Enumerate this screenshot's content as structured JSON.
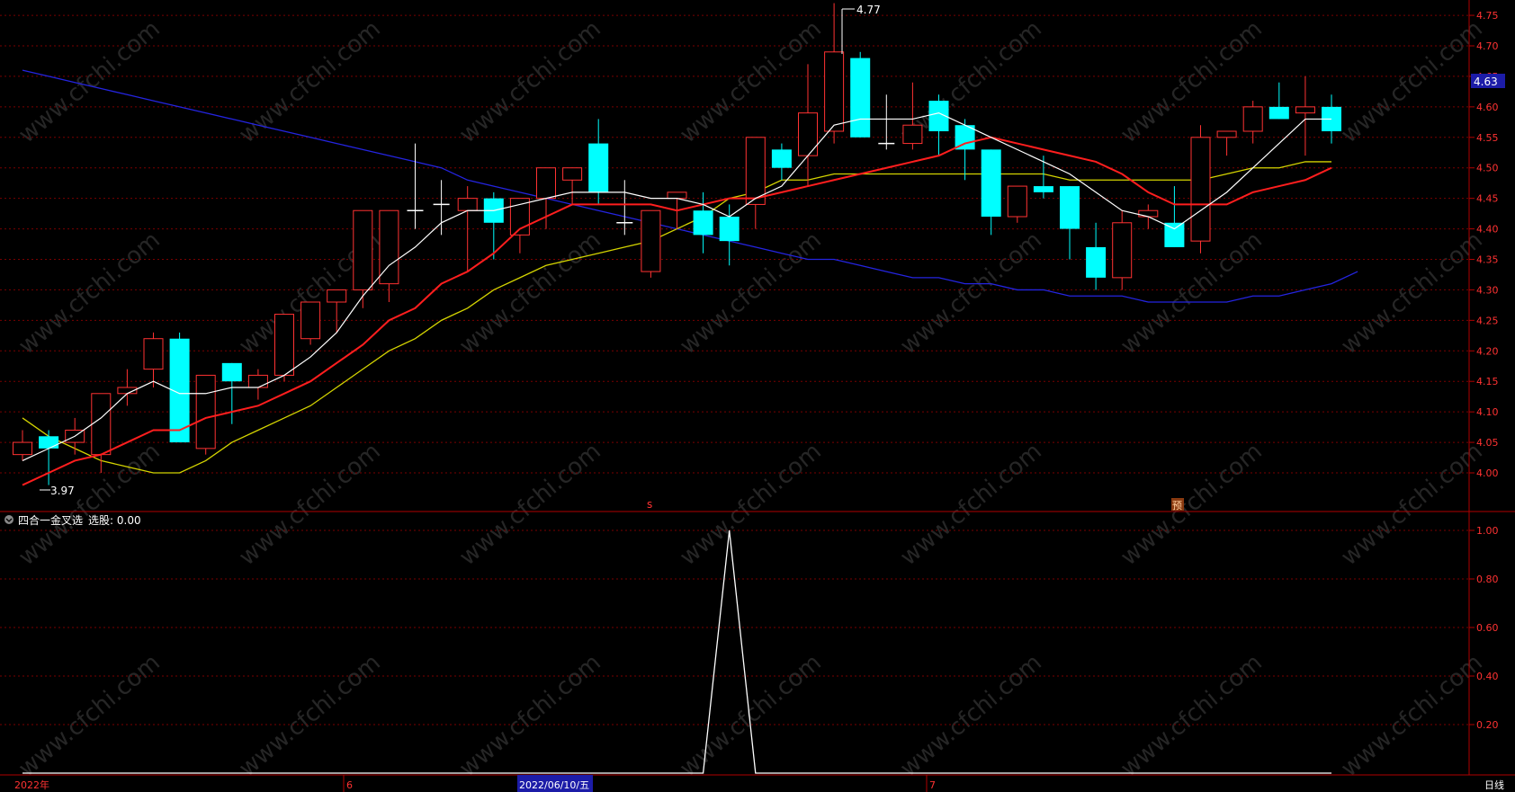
{
  "indicator": {
    "name": "四合一金叉选",
    "signal_label": "选股",
    "signal_value": "0.00",
    "yticks": [
      "1.00",
      "0.80",
      "0.60",
      "0.40",
      "0.20"
    ]
  },
  "timeline": {
    "year_label": "2022年",
    "month_june": "6",
    "month_july": "7",
    "cursor_date": "2022/06/10/五",
    "period": "日线"
  },
  "markers": {
    "s": "s",
    "forecast": "预"
  },
  "price": {
    "current": "4.63",
    "high_note": "4.77",
    "low_note": "3.97"
  },
  "colors": {
    "up": "#ff3232",
    "down": "#00ffff",
    "ma5": "#ffffff",
    "ma10": "#ff1e1e",
    "ma20": "#d4d400",
    "ma60": "#2424e0",
    "grid": "#7a0000",
    "axis": "#b00000"
  },
  "chart_data": [
    {
      "type": "candlestick",
      "ylim": [
        3.93,
        4.78
      ],
      "yticks": [
        4.0,
        4.05,
        4.1,
        4.15,
        4.2,
        4.25,
        4.3,
        4.35,
        4.4,
        4.45,
        4.5,
        4.55,
        4.6,
        4.65,
        4.7,
        4.75
      ],
      "ohlc": [
        [
          4.03,
          4.07,
          4.02,
          4.05
        ],
        [
          4.06,
          4.07,
          3.98,
          4.04
        ],
        [
          4.05,
          4.09,
          4.03,
          4.07
        ],
        [
          4.03,
          4.13,
          4.0,
          4.13
        ],
        [
          4.13,
          4.17,
          4.11,
          4.14
        ],
        [
          4.17,
          4.23,
          4.14,
          4.22
        ],
        [
          4.22,
          4.23,
          4.05,
          4.05
        ],
        [
          4.04,
          4.16,
          4.03,
          4.16
        ],
        [
          4.18,
          4.18,
          4.08,
          4.15
        ],
        [
          4.14,
          4.17,
          4.12,
          4.16
        ],
        [
          4.16,
          4.26,
          4.15,
          4.26
        ],
        [
          4.22,
          4.28,
          4.21,
          4.28
        ],
        [
          4.28,
          4.3,
          4.23,
          4.3
        ],
        [
          4.3,
          4.36,
          4.27,
          4.43
        ],
        [
          4.31,
          4.43,
          4.28,
          4.43
        ],
        [
          4.43,
          4.54,
          4.4,
          4.43
        ],
        [
          4.44,
          4.48,
          4.39,
          4.44
        ],
        [
          4.43,
          4.47,
          4.33,
          4.45
        ],
        [
          4.45,
          4.46,
          4.35,
          4.41
        ],
        [
          4.39,
          4.45,
          4.36,
          4.45
        ],
        [
          4.45,
          4.5,
          4.4,
          4.5
        ],
        [
          4.48,
          4.5,
          4.44,
          4.5
        ],
        [
          4.54,
          4.58,
          4.44,
          4.46
        ],
        [
          4.41,
          4.48,
          4.39,
          4.41
        ],
        [
          4.33,
          4.43,
          4.32,
          4.43
        ],
        [
          4.45,
          4.45,
          4.4,
          4.46
        ],
        [
          4.43,
          4.46,
          4.36,
          4.39
        ],
        [
          4.42,
          4.44,
          4.34,
          4.38
        ],
        [
          4.44,
          4.55,
          4.4,
          4.55
        ],
        [
          4.53,
          4.54,
          4.48,
          4.5
        ],
        [
          4.52,
          4.67,
          4.47,
          4.59
        ],
        [
          4.56,
          4.77,
          4.54,
          4.69
        ],
        [
          4.68,
          4.69,
          4.55,
          4.55
        ],
        [
          4.54,
          4.62,
          4.53,
          4.54
        ],
        [
          4.54,
          4.64,
          4.53,
          4.57
        ],
        [
          4.61,
          4.62,
          4.52,
          4.56
        ],
        [
          4.57,
          4.58,
          4.48,
          4.53
        ],
        [
          4.53,
          4.53,
          4.39,
          4.42
        ],
        [
          4.42,
          4.47,
          4.41,
          4.47
        ],
        [
          4.47,
          4.52,
          4.45,
          4.46
        ],
        [
          4.47,
          4.47,
          4.35,
          4.4
        ],
        [
          4.37,
          4.41,
          4.3,
          4.32
        ],
        [
          4.32,
          4.43,
          4.3,
          4.41
        ],
        [
          4.42,
          4.44,
          4.4,
          4.43
        ],
        [
          4.41,
          4.47,
          4.37,
          4.37
        ],
        [
          4.38,
          4.57,
          4.36,
          4.55
        ],
        [
          4.55,
          4.56,
          4.52,
          4.56
        ],
        [
          4.56,
          4.61,
          4.54,
          4.6
        ],
        [
          4.6,
          4.64,
          4.58,
          4.58
        ],
        [
          4.59,
          4.65,
          4.52,
          4.6
        ],
        [
          4.6,
          4.62,
          4.54,
          4.56
        ]
      ],
      "ma5": [
        4.02,
        4.04,
        4.06,
        4.09,
        4.13,
        4.15,
        4.13,
        4.13,
        4.14,
        4.14,
        4.16,
        4.19,
        4.23,
        4.29,
        4.34,
        4.37,
        4.41,
        4.43,
        4.43,
        4.44,
        4.45,
        4.46,
        4.46,
        4.46,
        4.45,
        4.45,
        4.44,
        4.42,
        4.45,
        4.47,
        4.52,
        4.57,
        4.58,
        4.58,
        4.58,
        4.59,
        4.57,
        4.55,
        4.53,
        4.51,
        4.49,
        4.46,
        4.43,
        4.42,
        4.4,
        4.43,
        4.46,
        4.5,
        4.54,
        4.58,
        4.58
      ],
      "ma10": [
        3.98,
        4.0,
        4.02,
        4.03,
        4.05,
        4.07,
        4.07,
        4.09,
        4.1,
        4.11,
        4.13,
        4.15,
        4.18,
        4.21,
        4.25,
        4.27,
        4.31,
        4.33,
        4.36,
        4.4,
        4.42,
        4.44,
        4.44,
        4.44,
        4.44,
        4.43,
        4.44,
        4.45,
        4.45,
        4.46,
        4.47,
        4.48,
        4.49,
        4.5,
        4.51,
        4.52,
        4.54,
        4.55,
        4.54,
        4.53,
        4.52,
        4.51,
        4.49,
        4.46,
        4.44,
        4.44,
        4.44,
        4.46,
        4.47,
        4.48,
        4.5
      ],
      "ma20": [
        4.09,
        4.06,
        4.04,
        4.02,
        4.01,
        4.0,
        4.0,
        4.02,
        4.05,
        4.07,
        4.09,
        4.11,
        4.14,
        4.17,
        4.2,
        4.22,
        4.25,
        4.27,
        4.3,
        4.32,
        4.34,
        4.35,
        4.36,
        4.37,
        4.38,
        4.4,
        4.42,
        4.45,
        4.46,
        4.48,
        4.48,
        4.49,
        4.49,
        4.49,
        4.49,
        4.49,
        4.49,
        4.49,
        4.49,
        4.49,
        4.48,
        4.48,
        4.48,
        4.48,
        4.48,
        4.48,
        4.49,
        4.5,
        4.5,
        4.51,
        4.51
      ],
      "ma60": [
        4.66,
        4.65,
        4.64,
        4.63,
        4.62,
        4.61,
        4.6,
        4.59,
        4.58,
        4.57,
        4.56,
        4.55,
        4.54,
        4.53,
        4.52,
        4.51,
        4.5,
        4.48,
        4.47,
        4.46,
        4.45,
        4.44,
        4.43,
        4.42,
        4.41,
        4.4,
        4.39,
        4.38,
        4.37,
        4.36,
        4.35,
        4.35,
        4.34,
        4.33,
        4.32,
        4.32,
        4.31,
        4.31,
        4.3,
        4.3,
        4.29,
        4.29,
        4.29,
        4.28,
        4.28,
        4.28,
        4.28,
        4.29,
        4.29,
        4.3,
        4.31,
        4.33
      ]
    },
    {
      "type": "line",
      "name": "选股",
      "ylim": [
        0,
        1.0
      ],
      "values": [
        0,
        0,
        0,
        0,
        0,
        0,
        0,
        0,
        0,
        0,
        0,
        0,
        0,
        0,
        0,
        0,
        0,
        0,
        0,
        0,
        0,
        0,
        0,
        0,
        0,
        0,
        0,
        1,
        0,
        0,
        0,
        0,
        0,
        0,
        0,
        0,
        0,
        0,
        0,
        0,
        0,
        0,
        0,
        0,
        0,
        0,
        0,
        0,
        0,
        0,
        0
      ]
    }
  ]
}
